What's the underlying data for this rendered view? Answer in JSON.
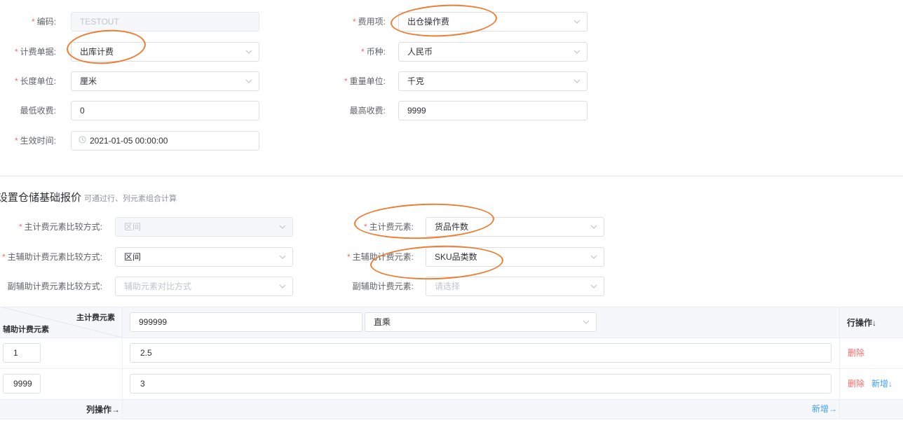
{
  "form": {
    "code": {
      "label": "编码:",
      "value": "TESTOUT"
    },
    "fee_item": {
      "label": "费用项:",
      "value": "出仓操作费"
    },
    "billing_doc": {
      "label": "计费单据:",
      "value": "出库计费"
    },
    "currency": {
      "label": "币种:",
      "value": "人民币"
    },
    "length_unit": {
      "label": "长度单位:",
      "value": "厘米"
    },
    "weight_unit": {
      "label": "重量单位:",
      "value": "千克"
    },
    "min_fee": {
      "label": "最低收费:",
      "value": "0"
    },
    "max_fee": {
      "label": "最高收费:",
      "value": "9999"
    },
    "effective_time": {
      "label": "生效时间:",
      "value": "2021-01-05 00:00:00"
    }
  },
  "section": {
    "title": "设置仓储基础报价",
    "subtitle": "可通过行、列元素组合计算"
  },
  "pricing": {
    "main_compare": {
      "label": "主计费元素比较方式:",
      "value": "区间"
    },
    "main_element": {
      "label": "主计费元素:",
      "value": "货品件数"
    },
    "main_aux_compare": {
      "label": "主辅助计费元素比较方式:",
      "value": "区间"
    },
    "main_aux_element": {
      "label": "主辅助计费元素:",
      "value": "SKU品类数"
    },
    "sub_aux_compare": {
      "label": "副辅助计费元素比较方式:",
      "placeholder": "辅助元素对比方式"
    },
    "sub_aux_element": {
      "label": "副辅助计费元素:",
      "placeholder": "请选择"
    }
  },
  "matrix": {
    "corner_top": "主计费元素",
    "corner_bottom": "辅助计费元素",
    "column_value": "999999",
    "column_mode": "直乘",
    "row_ops_header": "行操作↓",
    "rows": [
      {
        "key": "1",
        "value": "2.5",
        "delete": "删除"
      },
      {
        "key": "9999",
        "value": "3",
        "delete": "删除",
        "add": "新增↓"
      }
    ],
    "col_ops_label": "列操作→",
    "col_add": "新增→"
  },
  "colors": {
    "accent": "#409eff",
    "danger": "#f56c6c",
    "annotation": "#ed7d31"
  }
}
